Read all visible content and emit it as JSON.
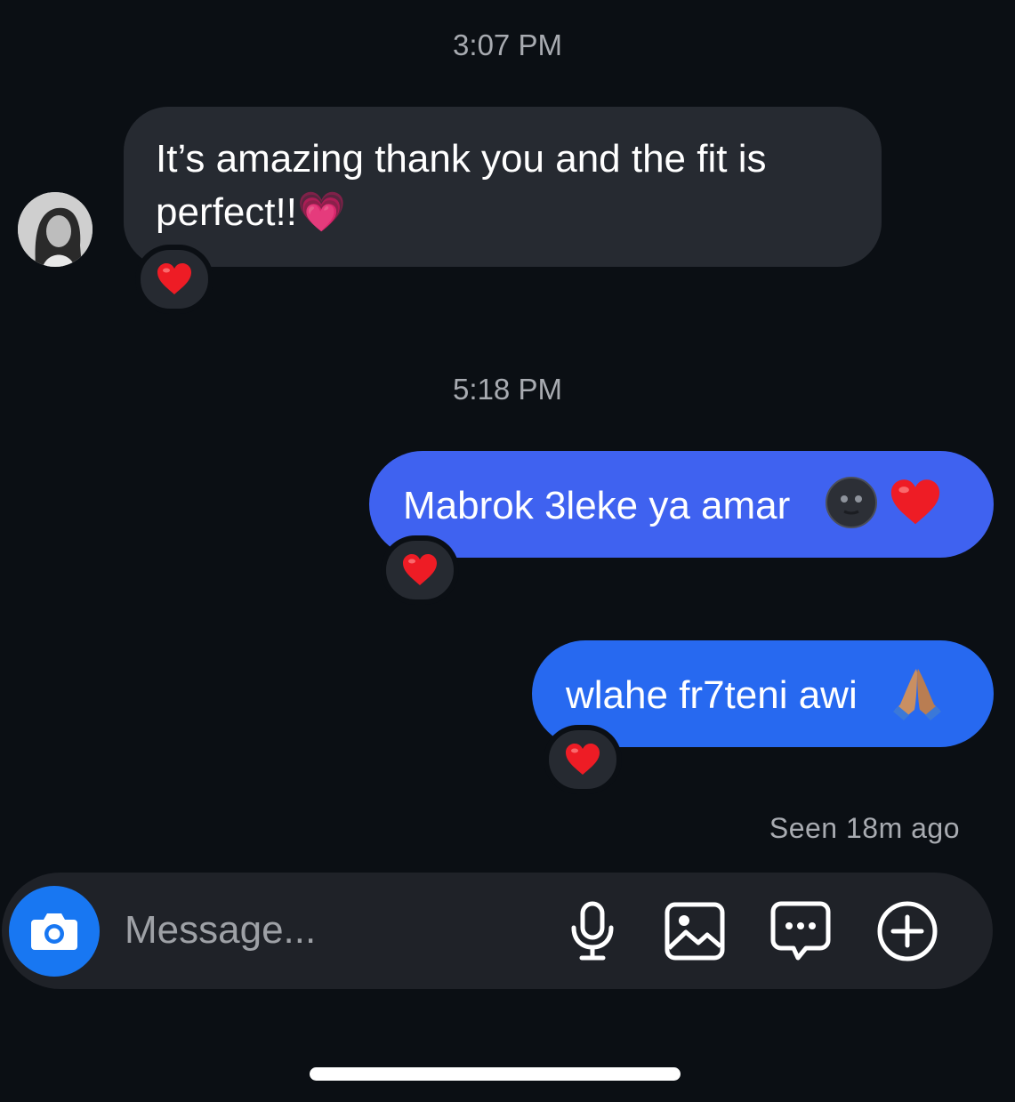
{
  "conversation": {
    "time_1": "3:07 PM",
    "time_2": "5:18 PM",
    "messages": [
      {
        "direction": "incoming",
        "text_line1": "It’s amazing thank you and the fit is",
        "text_line2": "perfect!!",
        "emoji": "💗",
        "reaction": "❤️"
      },
      {
        "direction": "outgoing",
        "text": "Mabrok 3leke ya amar",
        "emoji": "🌚❤️",
        "reaction": "❤️"
      },
      {
        "direction": "outgoing",
        "text": "wlahe fr7teni awi",
        "emoji": "🙏🏽",
        "reaction": "❤️"
      }
    ],
    "seen_status": "Seen 18m ago"
  },
  "composer": {
    "placeholder": "Message...",
    "icons": [
      "camera-icon",
      "microphone-icon",
      "gallery-icon",
      "sticker-chat-icon",
      "plus-circle-icon"
    ]
  },
  "colors": {
    "background": "#0b0f14",
    "incoming_bubble": "#262a31",
    "outgoing_bubble_1": "#3f62f0",
    "outgoing_bubble_2": "#2769f0",
    "camera_button": "#1877f2",
    "heart": "#ee1c25"
  }
}
